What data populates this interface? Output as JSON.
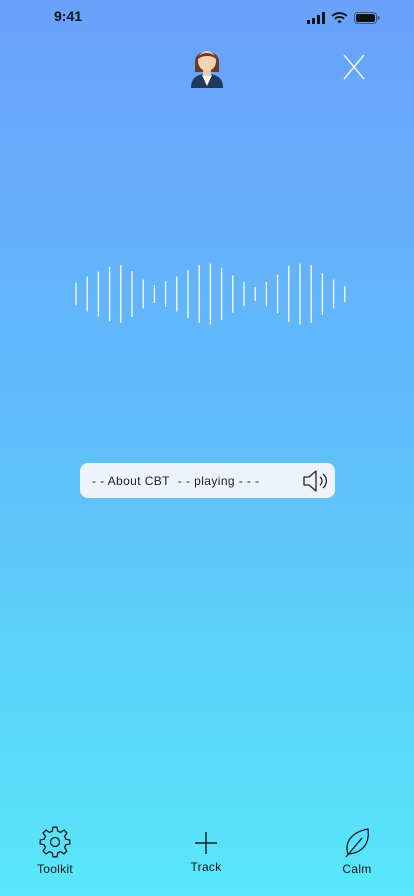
{
  "status_bar": {
    "time": "9:41",
    "icons": [
      "signal-icon",
      "wifi-icon",
      "battery-icon"
    ]
  },
  "header": {
    "avatar_icon": "therapist-avatar-icon",
    "close_icon": "close-icon"
  },
  "player": {
    "title": "- - About CBT",
    "state": "- - playing - - -",
    "speaker_icon": "speaker-icon"
  },
  "waveform": {
    "color": "#ffffff",
    "bar_levels": [
      0.35,
      0.55,
      0.7,
      0.85,
      0.9,
      0.72,
      0.45,
      0.28,
      0.4,
      0.55,
      0.75,
      0.9,
      0.95,
      0.82,
      0.58,
      0.38,
      0.22,
      0.38,
      0.6,
      0.88,
      0.95,
      0.9,
      0.65,
      0.45,
      0.25
    ]
  },
  "tab_bar": {
    "tabs": [
      {
        "label": "Toolkit",
        "icon": "gear-icon"
      },
      {
        "label": "Track",
        "icon": "plus-icon"
      },
      {
        "label": "Calm",
        "icon": "leaf-icon"
      }
    ]
  }
}
